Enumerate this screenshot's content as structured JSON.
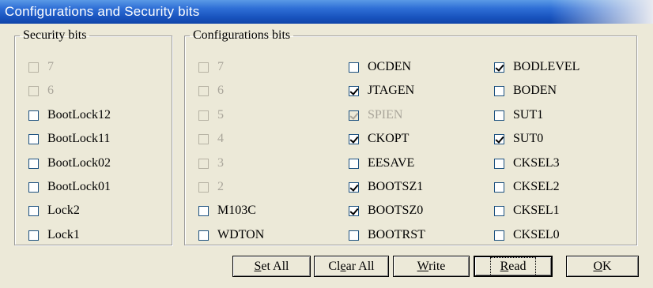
{
  "window": {
    "title": "Configurations and Security bits"
  },
  "security": {
    "legend": "Security bits",
    "items": [
      {
        "label": "7",
        "checked": false,
        "disabled": true
      },
      {
        "label": "6",
        "checked": false,
        "disabled": true
      },
      {
        "label": "BootLock12",
        "checked": false,
        "disabled": false
      },
      {
        "label": "BootLock11",
        "checked": false,
        "disabled": false
      },
      {
        "label": "BootLock02",
        "checked": false,
        "disabled": false
      },
      {
        "label": "BootLock01",
        "checked": false,
        "disabled": false
      },
      {
        "label": "Lock2",
        "checked": false,
        "disabled": false
      },
      {
        "label": "Lock1",
        "checked": false,
        "disabled": false
      }
    ]
  },
  "config": {
    "legend": "Configurations bits",
    "col1": [
      {
        "label": "7",
        "checked": false,
        "disabled": true
      },
      {
        "label": "6",
        "checked": false,
        "disabled": true
      },
      {
        "label": "5",
        "checked": false,
        "disabled": true
      },
      {
        "label": "4",
        "checked": false,
        "disabled": true
      },
      {
        "label": "3",
        "checked": false,
        "disabled": true
      },
      {
        "label": "2",
        "checked": false,
        "disabled": true
      },
      {
        "label": "M103C",
        "checked": false,
        "disabled": false
      },
      {
        "label": "WDTON",
        "checked": false,
        "disabled": false
      }
    ],
    "col2": [
      {
        "label": "OCDEN",
        "checked": false,
        "disabled": false
      },
      {
        "label": "JTAGEN",
        "checked": true,
        "disabled": false
      },
      {
        "label": "SPIEN",
        "checked": true,
        "disabled": true
      },
      {
        "label": "CKOPT",
        "checked": true,
        "disabled": false
      },
      {
        "label": "EESAVE",
        "checked": false,
        "disabled": false
      },
      {
        "label": "BOOTSZ1",
        "checked": true,
        "disabled": false
      },
      {
        "label": "BOOTSZ0",
        "checked": true,
        "disabled": false
      },
      {
        "label": "BOOTRST",
        "checked": false,
        "disabled": false
      }
    ],
    "col3": [
      {
        "label": "BODLEVEL",
        "checked": true,
        "disabled": false
      },
      {
        "label": "BODEN",
        "checked": false,
        "disabled": false
      },
      {
        "label": "SUT1",
        "checked": false,
        "disabled": false
      },
      {
        "label": "SUT0",
        "checked": true,
        "disabled": false
      },
      {
        "label": "CKSEL3",
        "checked": false,
        "disabled": false
      },
      {
        "label": "CKSEL2",
        "checked": false,
        "disabled": false
      },
      {
        "label": "CKSEL1",
        "checked": false,
        "disabled": false
      },
      {
        "label": "CKSEL0",
        "checked": false,
        "disabled": false
      }
    ]
  },
  "buttons": {
    "set_all": {
      "mnemonic": "S",
      "rest": "et All"
    },
    "clear_all": {
      "pre": "Cl",
      "mnemonic": "e",
      "rest": "ar All"
    },
    "write": {
      "mnemonic": "W",
      "rest": "rite"
    },
    "read": {
      "mnemonic": "R",
      "rest": "ead"
    },
    "ok": {
      "mnemonic": "O",
      "rest": "K"
    }
  }
}
